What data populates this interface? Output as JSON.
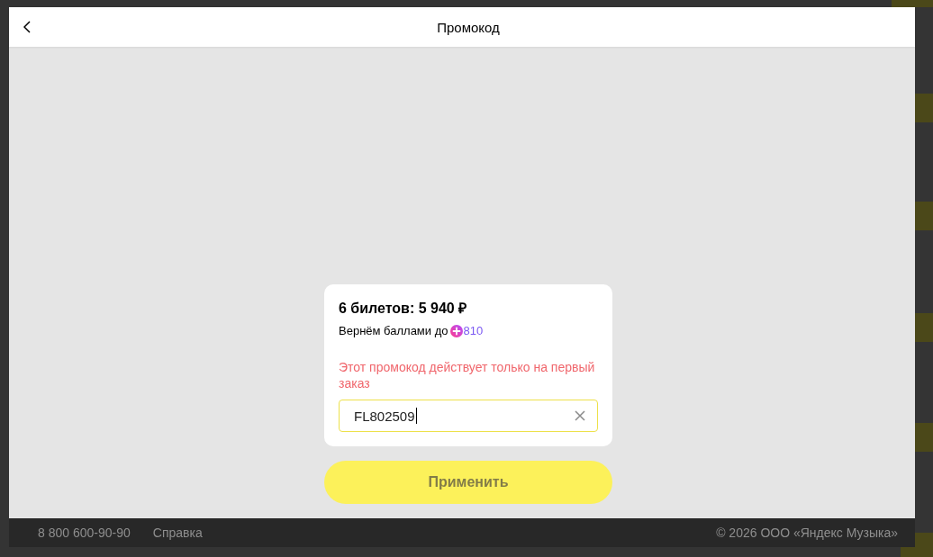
{
  "dialog": {
    "title": "Промокод",
    "order": {
      "summary": "6 билетов: 5 940 ₽",
      "cashback_label": "Вернём баллами до",
      "cashback_points": "810"
    },
    "error_message": "Этот промокод действует только на первый заказ",
    "promo_field": {
      "value": "FL802509",
      "focused": true
    },
    "apply_button": {
      "label": "Применить",
      "disabled": true
    }
  },
  "footer": {
    "phone": "8 800 600-90-90",
    "help_link": "Справка",
    "copyright": "© 2026 ООО «Яндекс Музыка»"
  }
}
